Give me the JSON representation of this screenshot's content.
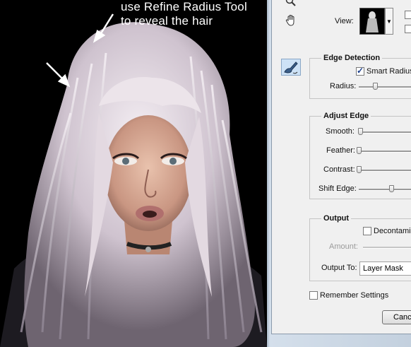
{
  "annotation": {
    "line1": "use Refine Radius Tool",
    "line2": "to reveal the hair"
  },
  "dialog": {
    "view": {
      "label": "View:"
    },
    "edge_detection": {
      "title": "Edge Detection",
      "smart_radius_label": "Smart Radius",
      "smart_radius_checked": true,
      "radius_label": "Radius:",
      "radius_level": 0.25
    },
    "adjust_edge": {
      "title": "Adjust Edge",
      "smooth_label": "Smooth:",
      "smooth_level": 0.02,
      "feather_label": "Feather:",
      "feather_level": 0.0,
      "contrast_label": "Contrast:",
      "contrast_level": 0.0,
      "shift_edge_label": "Shift Edge:",
      "shift_edge_level": 0.5
    },
    "output": {
      "title": "Output",
      "decontaminate_label": "Decontamin",
      "decontaminate_checked": false,
      "amount_label": "Amount:",
      "output_to_label": "Output To:",
      "output_to_value": "Layer Mask"
    },
    "remember_settings_label": "Remember Settings",
    "remember_settings_checked": false,
    "cancel_label": "Canc"
  },
  "icons": [
    "zoom-icon",
    "hand-icon",
    "refine-radius-brush-icon",
    "dropdown-arrow-icon",
    "annotation-arrow-icon"
  ]
}
